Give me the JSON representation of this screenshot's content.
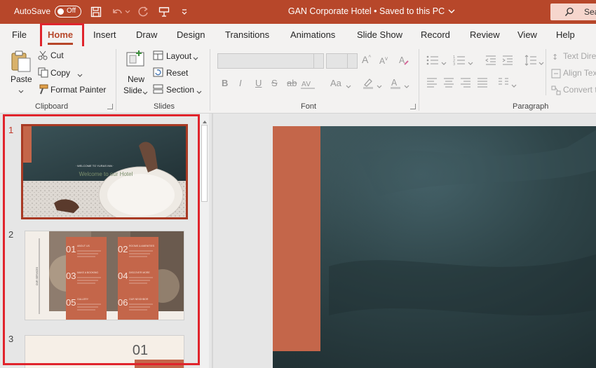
{
  "titlebar": {
    "autosave_label": "AutoSave",
    "autosave_state": "Off",
    "title": "GAN Corporate Hotel  •  Saved to this PC",
    "search_label": "Sea"
  },
  "ribbon_tabs": [
    "File",
    "Home",
    "Insert",
    "Draw",
    "Design",
    "Transitions",
    "Animations",
    "Slide Show",
    "Record",
    "Review",
    "View",
    "Help"
  ],
  "clipboard": {
    "paste": "Paste",
    "cut": "Cut",
    "copy": "Copy",
    "format_painter": "Format Painter",
    "group_label": "Clipboard"
  },
  "slides": {
    "new_slide_1": "New",
    "new_slide_2": "Slide",
    "layout": "Layout",
    "reset": "Reset",
    "section": "Section",
    "group_label": "Slides"
  },
  "font": {
    "group_label": "Font",
    "bold": "B",
    "italic": "I",
    "underline": "U",
    "shadow": "S",
    "strike": "ab",
    "case": "Aa"
  },
  "paragraph": {
    "group_label": "Paragraph",
    "text_direction": "Text Direc",
    "align_text": "Align Tex",
    "convert": "Convert t"
  },
  "thumbnails": [
    {
      "number": "1",
      "tagline": "· WELCOME TO YURAS INN ·",
      "headline": "Welcome to our Hotel"
    },
    {
      "number": "2",
      "side_label": "OUR SERVICES",
      "items": [
        {
          "num": "01",
          "title": "ABOUT US"
        },
        {
          "num": "02",
          "title": "ROOMS & AMENITIES"
        },
        {
          "num": "03",
          "title": "MAKE A BOOKING"
        },
        {
          "num": "04",
          "title": "DISCOVER MORE"
        },
        {
          "num": "05",
          "title": "GALLERY"
        },
        {
          "num": "06",
          "title": "OUR NEIGHBOR"
        }
      ]
    },
    {
      "number": "3",
      "headline": "01"
    }
  ],
  "colors": {
    "titlebar": "#b7472a",
    "accent": "#c4664a",
    "slide_dark": "#2b3d41",
    "highlight": "#e0242c"
  }
}
